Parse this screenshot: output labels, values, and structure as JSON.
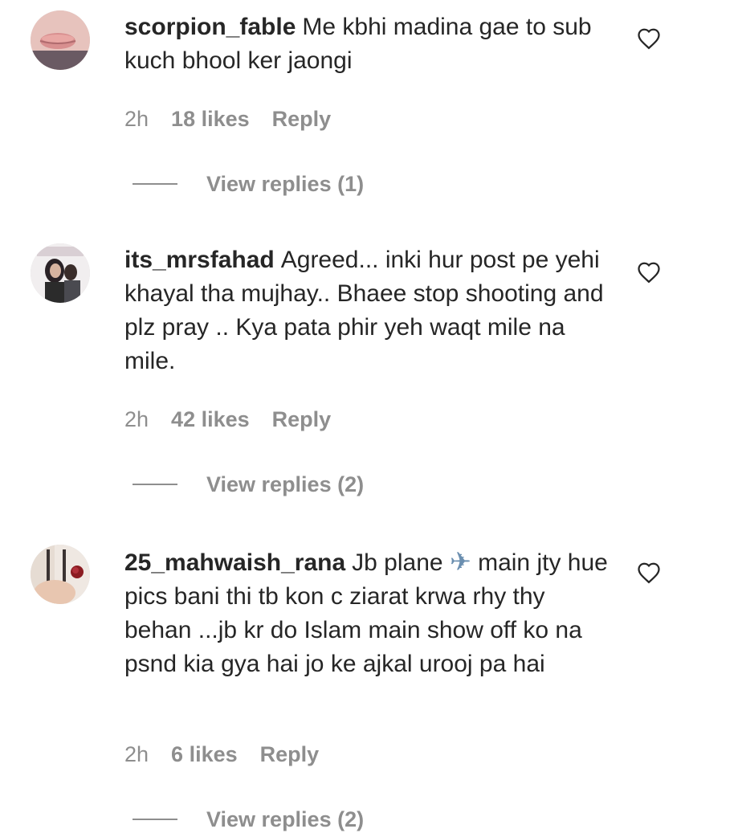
{
  "comments": [
    {
      "username": "scorpion_fable",
      "text": "Me kbhi madina gae to sub kuch bhool ker jaongi",
      "time": "2h",
      "likes": "18 likes",
      "reply": "Reply",
      "view_replies": "View replies (1)",
      "avatar_icon": "lips-avatar",
      "like_icon": "heart-outline-icon"
    },
    {
      "username": "its_mrsfahad",
      "text": "Agreed... inki hur post pe yehi khayal tha mujhay.. Bhaee stop shooting and plz pray .. Kya pata phir yeh waqt mile na mile.",
      "time": "2h",
      "likes": "42 likes",
      "reply": "Reply",
      "view_replies": "View replies (2)",
      "avatar_icon": "couple-photo-avatar",
      "like_icon": "heart-outline-icon"
    },
    {
      "username": "25_mahwaish_rana",
      "text_before": "Jb plane",
      "emoji": "✈",
      "text_after": "main jty hue pics bani thi tb kon c ziarat krwa rhy thy behan ...jb kr do Islam main show off ko na psnd kia gya hai jo ke ajkal urooj pa hai",
      "time": "2h",
      "likes": "6 likes",
      "reply": "Reply",
      "view_replies": "View replies (2)",
      "avatar_icon": "rose-photo-avatar",
      "like_icon": "heart-outline-icon"
    }
  ],
  "colors": {
    "text": "#262626",
    "muted": "#8e8e8e",
    "background": "#ffffff"
  }
}
